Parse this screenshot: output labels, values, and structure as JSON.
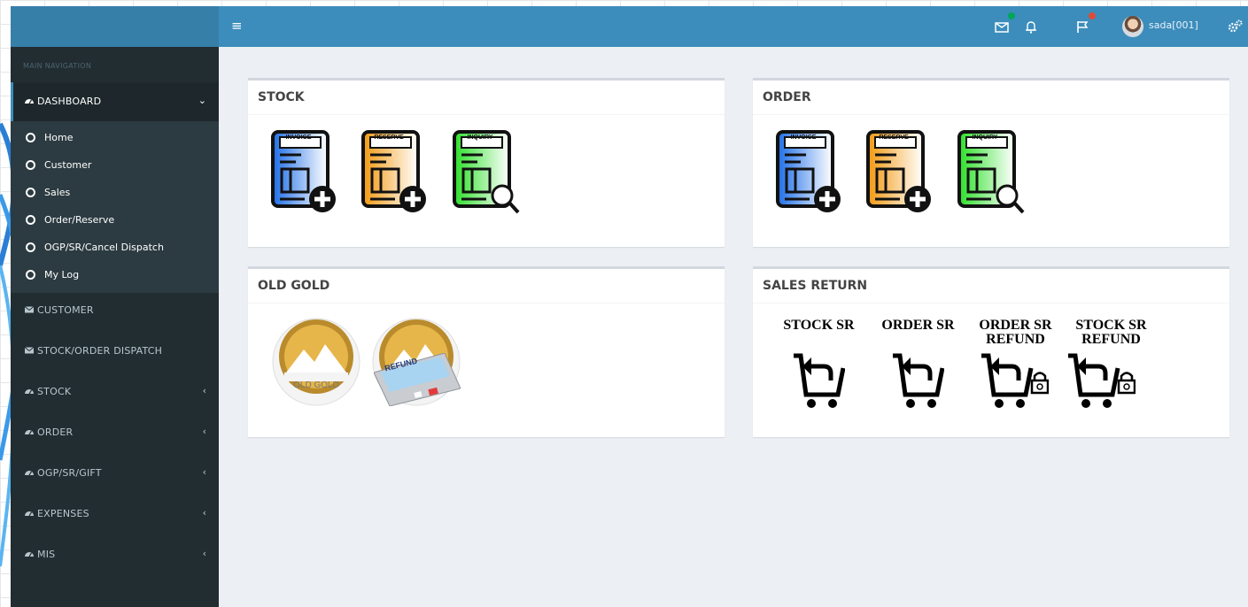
{
  "header": {
    "menu_toggle": "≡",
    "user_name": "sada[001]",
    "icons": [
      "envelope-icon",
      "bell-icon",
      "flag-icon",
      "avatar",
      "gears-icon"
    ],
    "badge_colors": {
      "messages": "#00a65a",
      "flags": "#dd4b39"
    }
  },
  "sidebar": {
    "header": "MAIN NAVIGATION",
    "dashboard": {
      "label": "DASHBOARD",
      "arrow": "⌄"
    },
    "submenu": [
      {
        "label": "Home"
      },
      {
        "label": "Customer"
      },
      {
        "label": "Sales"
      },
      {
        "label": "Order/Reserve"
      },
      {
        "label": "OGP/SR/Cancel Dispatch"
      },
      {
        "label": "My Log"
      }
    ],
    "items": [
      {
        "label": "CUSTOMER",
        "icon": "envelope-icon"
      },
      {
        "label": "STOCK/ORDER DISPATCH",
        "icon": "envelope-icon"
      },
      {
        "label": "STOCK",
        "icon": "dashboard-icon",
        "arrow": "‹"
      },
      {
        "label": "ORDER",
        "icon": "dashboard-icon",
        "arrow": "‹"
      },
      {
        "label": "OGP/SR/GIFT",
        "icon": "dashboard-icon",
        "arrow": "‹"
      },
      {
        "label": "EXPENSES",
        "icon": "dashboard-icon",
        "arrow": "‹"
      },
      {
        "label": "MIS",
        "icon": "dashboard-icon",
        "arrow": "‹"
      }
    ]
  },
  "boxes": {
    "stock": {
      "title": "STOCK",
      "icons": [
        {
          "tag": "INVOICE",
          "color": "#1f6fe8",
          "action": "plus"
        },
        {
          "tag": "RESERVE",
          "color": "#f39a12",
          "action": "plus"
        },
        {
          "tag": "INQUIRY",
          "color": "#2ee02a",
          "action": "search"
        }
      ]
    },
    "order": {
      "title": "ORDER",
      "icons": [
        {
          "tag": "INVOICE",
          "color": "#1f6fe8",
          "action": "plus"
        },
        {
          "tag": "RESERVE",
          "color": "#f39a12",
          "action": "plus"
        },
        {
          "tag": "INQUIRY",
          "color": "#2ee02a",
          "action": "search"
        }
      ]
    },
    "old_gold": {
      "title": "OLD GOLD",
      "coin_label": "OLD GOLD",
      "refund_text": "REFUND"
    },
    "sales_return": {
      "title": "SALES RETURN",
      "items": [
        {
          "line1": "STOCK SR",
          "line2": "",
          "lock": false
        },
        {
          "line1": "ORDER SR",
          "line2": "",
          "lock": false
        },
        {
          "line1": "ORDER SR",
          "line2": "REFUND",
          "lock": true
        },
        {
          "line1": "STOCK SR",
          "line2": "REFUND",
          "lock": true
        }
      ]
    }
  },
  "colors": {
    "header": "#3c8dbc",
    "sidebar": "#222d32",
    "submenu": "#2c3b41",
    "content_bg": "#ecf0f5"
  }
}
